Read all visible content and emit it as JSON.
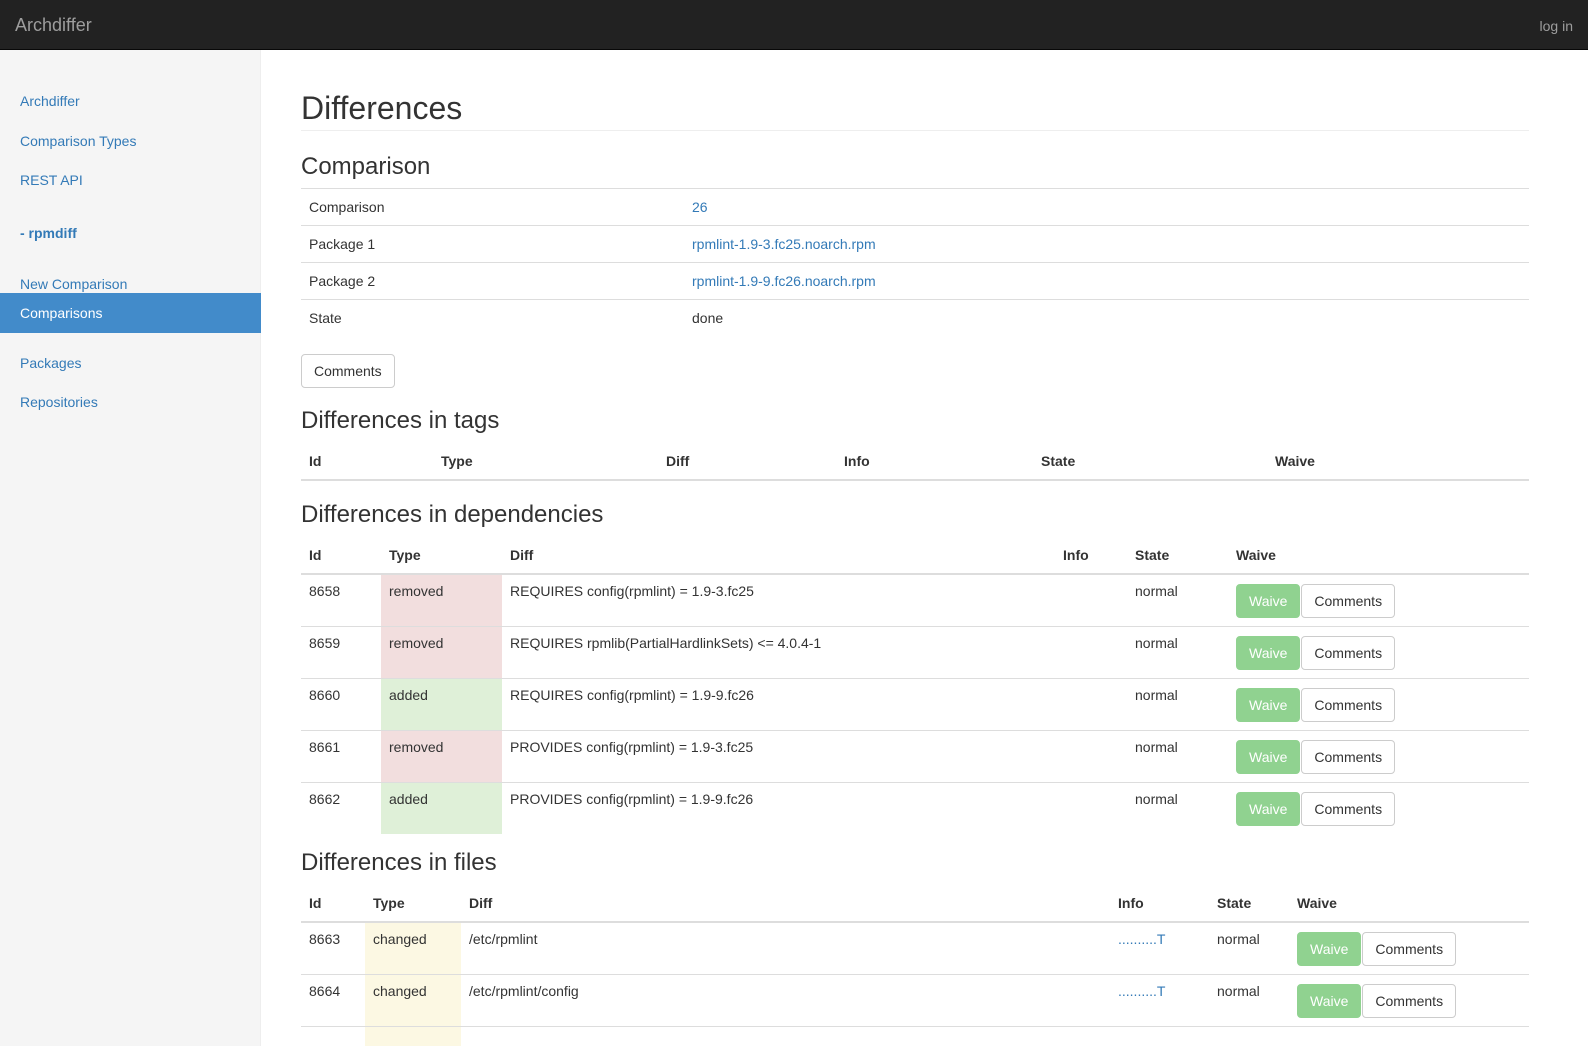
{
  "navbar": {
    "brand": "Archdiffer",
    "login": "log in"
  },
  "sidebar": {
    "items_top": [
      {
        "label": "Archdiffer"
      },
      {
        "label": "Comparison Types"
      },
      {
        "label": "REST API"
      }
    ],
    "section_header": "- rpmdiff",
    "items_section": [
      {
        "label": "New Comparison",
        "active": false
      },
      {
        "label": "Comparisons",
        "active": true
      },
      {
        "label": "Packages",
        "active": false
      },
      {
        "label": "Repositories",
        "active": false
      }
    ]
  },
  "main": {
    "title": "Differences",
    "comparison": {
      "heading": "Comparison",
      "rows": [
        {
          "key": "Comparison",
          "value": "26",
          "link": true
        },
        {
          "key": "Package 1",
          "value": "rpmlint-1.9-3.fc25.noarch.rpm",
          "link": true
        },
        {
          "key": "Package 2",
          "value": "rpmlint-1.9-9.fc26.noarch.rpm",
          "link": true
        },
        {
          "key": "State",
          "value": "done",
          "link": false
        }
      ],
      "comments_button": "Comments"
    },
    "tags": {
      "heading": "Differences in tags",
      "columns": [
        "Id",
        "Type",
        "Diff",
        "Info",
        "State",
        "Waive"
      ]
    },
    "dependencies": {
      "heading": "Differences in dependencies",
      "columns": [
        "Id",
        "Type",
        "Diff",
        "Info",
        "State",
        "Waive"
      ],
      "rows": [
        {
          "id": "8658",
          "type": "removed",
          "diff": "REQUIRES config(rpmlint) = 1.9-3.fc25",
          "info": "",
          "state": "normal"
        },
        {
          "id": "8659",
          "type": "removed",
          "diff": "REQUIRES rpmlib(PartialHardlinkSets) <= 4.0.4-1",
          "info": "",
          "state": "normal"
        },
        {
          "id": "8660",
          "type": "added",
          "diff": "REQUIRES config(rpmlint) = 1.9-9.fc26",
          "info": "",
          "state": "normal"
        },
        {
          "id": "8661",
          "type": "removed",
          "diff": "PROVIDES config(rpmlint) = 1.9-3.fc25",
          "info": "",
          "state": "normal"
        },
        {
          "id": "8662",
          "type": "added",
          "diff": "PROVIDES config(rpmlint) = 1.9-9.fc26",
          "info": "",
          "state": "normal"
        }
      ]
    },
    "files": {
      "heading": "Differences in files",
      "columns": [
        "Id",
        "Type",
        "Diff",
        "Info",
        "State",
        "Waive"
      ],
      "rows": [
        {
          "id": "8663",
          "type": "changed",
          "diff": "/etc/rpmlint",
          "info": "..........T",
          "state": "normal"
        },
        {
          "id": "8664",
          "type": "changed",
          "diff": "/etc/rpmlint/config",
          "info": "..........T",
          "state": "normal"
        }
      ]
    },
    "waive_label": "Waive",
    "row_comments_label": "Comments"
  }
}
